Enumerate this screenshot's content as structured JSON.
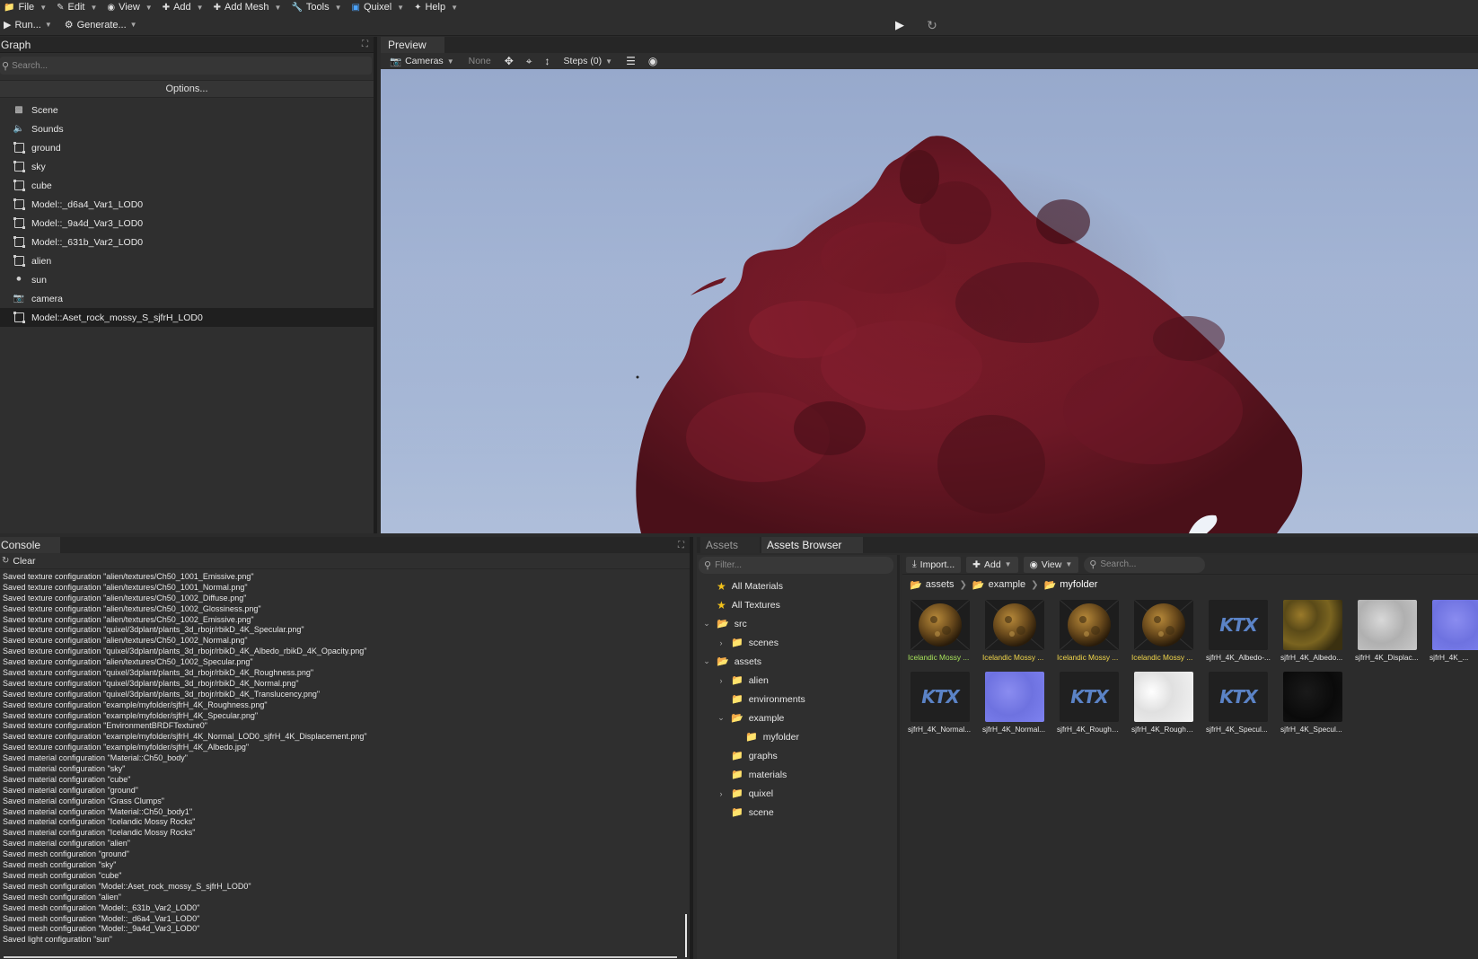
{
  "menubar": {
    "items": [
      {
        "label": "File",
        "icon": "folder-icon"
      },
      {
        "label": "Edit",
        "icon": "edit-icon"
      },
      {
        "label": "View",
        "icon": "eye-icon"
      },
      {
        "label": "Add",
        "icon": "plus-icon"
      },
      {
        "label": "Add Mesh",
        "icon": "plus-icon"
      },
      {
        "label": "Tools",
        "icon": "wrench-icon"
      },
      {
        "label": "Quixel",
        "icon": "quixel-icon"
      },
      {
        "label": "Help",
        "icon": "help-icon"
      }
    ]
  },
  "toolbar": {
    "run_label": "Run...",
    "generate_label": "Generate..."
  },
  "graph": {
    "title": "Graph",
    "search_placeholder": "Search...",
    "options_label": "Options...",
    "items": [
      {
        "label": "Scene",
        "icon": "scene-icon"
      },
      {
        "label": "Sounds",
        "icon": "speaker-icon"
      },
      {
        "label": "ground",
        "icon": "node-icon"
      },
      {
        "label": "sky",
        "icon": "node-icon"
      },
      {
        "label": "cube",
        "icon": "node-icon"
      },
      {
        "label": "Model::_d6a4_Var1_LOD0",
        "icon": "node-icon"
      },
      {
        "label": "Model::_9a4d_Var3_LOD0",
        "icon": "node-icon"
      },
      {
        "label": "Model::_631b_Var2_LOD0",
        "icon": "node-icon"
      },
      {
        "label": "alien",
        "icon": "node-icon"
      },
      {
        "label": "sun",
        "icon": "bulb-icon"
      },
      {
        "label": "camera",
        "icon": "camera-icon"
      },
      {
        "label": "Model::Aset_rock_mossy_S_sjfrH_LOD0",
        "icon": "node-icon",
        "selected": true
      }
    ]
  },
  "preview": {
    "tab_label": "Preview",
    "cameras_label": "Cameras",
    "none_label": "None",
    "steps_label": "Steps (0)"
  },
  "console": {
    "tab_label": "Console",
    "clear_label": "Clear",
    "lines": [
      "Saved texture configuration \"alien/textures/Ch50_1001_Emissive.png\"",
      "Saved texture configuration \"alien/textures/Ch50_1001_Normal.png\"",
      "Saved texture configuration \"alien/textures/Ch50_1002_Diffuse.png\"",
      "Saved texture configuration \"alien/textures/Ch50_1002_Glossiness.png\"",
      "Saved texture configuration \"alien/textures/Ch50_1002_Emissive.png\"",
      "Saved texture configuration \"quixel/3dplant/plants_3d_rbojr/rbikD_4K_Specular.png\"",
      "Saved texture configuration \"alien/textures/Ch50_1002_Normal.png\"",
      "Saved texture configuration \"quixel/3dplant/plants_3d_rbojr/rbikD_4K_Albedo_rbikD_4K_Opacity.png\"",
      "Saved texture configuration \"alien/textures/Ch50_1002_Specular.png\"",
      "Saved texture configuration \"quixel/3dplant/plants_3d_rbojr/rbikD_4K_Roughness.png\"",
      "Saved texture configuration \"quixel/3dplant/plants_3d_rbojr/rbikD_4K_Normal.png\"",
      "Saved texture configuration \"quixel/3dplant/plants_3d_rbojr/rbikD_4K_Translucency.png\"",
      "Saved texture configuration \"example/myfolder/sjfrH_4K_Roughness.png\"",
      "Saved texture configuration \"example/myfolder/sjfrH_4K_Specular.png\"",
      "Saved texture configuration \"EnvironmentBRDFTexture0\"",
      "Saved texture configuration \"example/myfolder/sjfrH_4K_Normal_LOD0_sjfrH_4K_Displacement.png\"",
      "Saved texture configuration \"example/myfolder/sjfrH_4K_Albedo.jpg\"",
      "Saved material configuration \"Material::Ch50_body\"",
      "Saved material configuration \"sky\"",
      "Saved material configuration \"cube\"",
      "Saved material configuration \"ground\"",
      "Saved material configuration \"Grass Clumps\"",
      "Saved material configuration \"Material::Ch50_body1\"",
      "Saved material configuration \"Icelandic Mossy Rocks\"",
      "Saved material configuration \"Icelandic Mossy Rocks\"",
      "Saved material configuration \"alien\"",
      "Saved mesh configuration \"ground\"",
      "Saved mesh configuration \"sky\"",
      "Saved mesh configuration \"cube\"",
      "Saved mesh configuration \"Model::Aset_rock_mossy_S_sjfrH_LOD0\"",
      "Saved mesh configuration \"alien\"",
      "Saved mesh configuration \"Model::_631b_Var2_LOD0\"",
      "Saved mesh configuration \"Model::_d6a4_Var1_LOD0\"",
      "Saved mesh configuration \"Model::_9a4d_Var3_LOD0\"",
      "Saved light configuration \"sun\""
    ]
  },
  "assets": {
    "tabs": [
      {
        "label": "Assets",
        "active": false
      },
      {
        "label": "Assets Browser",
        "active": true
      }
    ],
    "filter_placeholder": "Filter...",
    "tree": [
      {
        "label": "All Materials",
        "type": "star",
        "depth": 0,
        "chevron": ""
      },
      {
        "label": "All Textures",
        "type": "star",
        "depth": 0,
        "chevron": ""
      },
      {
        "label": "src",
        "type": "folder-open",
        "depth": 0,
        "chevron": "down"
      },
      {
        "label": "scenes",
        "type": "folder",
        "depth": 1,
        "chevron": "right"
      },
      {
        "label": "assets",
        "type": "folder-open",
        "depth": 0,
        "chevron": "down"
      },
      {
        "label": "alien",
        "type": "folder",
        "depth": 1,
        "chevron": "right"
      },
      {
        "label": "environments",
        "type": "folder",
        "depth": 1,
        "chevron": ""
      },
      {
        "label": "example",
        "type": "folder-open",
        "depth": 1,
        "chevron": "down"
      },
      {
        "label": "myfolder",
        "type": "folder",
        "depth": 2,
        "chevron": ""
      },
      {
        "label": "graphs",
        "type": "folder",
        "depth": 1,
        "chevron": ""
      },
      {
        "label": "materials",
        "type": "folder",
        "depth": 1,
        "chevron": ""
      },
      {
        "label": "quixel",
        "type": "folder",
        "depth": 1,
        "chevron": "right"
      },
      {
        "label": "scene",
        "type": "folder",
        "depth": 1,
        "chevron": ""
      }
    ],
    "toolbar": {
      "import_label": "Import...",
      "add_label": "Add",
      "view_label": "View",
      "search_placeholder": "Search..."
    },
    "breadcrumb": [
      "assets",
      "example",
      "myfolder"
    ],
    "items": [
      {
        "caption": "Icelandic Mossy ...",
        "kind": "sphere",
        "caption_color": "green"
      },
      {
        "caption": "Icelandic Mossy ...",
        "kind": "sphere",
        "caption_color": "yellow"
      },
      {
        "caption": "Icelandic Mossy ...",
        "kind": "sphere",
        "caption_color": "yellow"
      },
      {
        "caption": "Icelandic Mossy ...",
        "kind": "sphere",
        "caption_color": "yellow"
      },
      {
        "caption": "sjfrH_4K_Albedo-...",
        "kind": "ktx",
        "caption_color": "white"
      },
      {
        "caption": "sjfrH_4K_Albedo...",
        "kind": "moss",
        "caption_color": "white"
      },
      {
        "caption": "sjfrH_4K_Displac...",
        "kind": "gray",
        "caption_color": "white"
      },
      {
        "caption": "sjfrH_4K_...",
        "kind": "normal",
        "caption_color": "white"
      },
      {
        "caption": "sjfrH_4K_Normal...",
        "kind": "ktx",
        "caption_color": "white"
      },
      {
        "caption": "sjfrH_4K_Normal...",
        "kind": "normal",
        "caption_color": "white"
      },
      {
        "caption": "sjfrH_4K_Roughn...",
        "kind": "ktx",
        "caption_color": "white"
      },
      {
        "caption": "sjfrH_4K_Roughn...",
        "kind": "white",
        "caption_color": "white"
      },
      {
        "caption": "sjfrH_4K_Specul...",
        "kind": "ktx",
        "caption_color": "white"
      },
      {
        "caption": "sjfrH_4K_Specul...",
        "kind": "dark",
        "caption_color": "white"
      }
    ],
    "ktx_text": "KTX"
  }
}
